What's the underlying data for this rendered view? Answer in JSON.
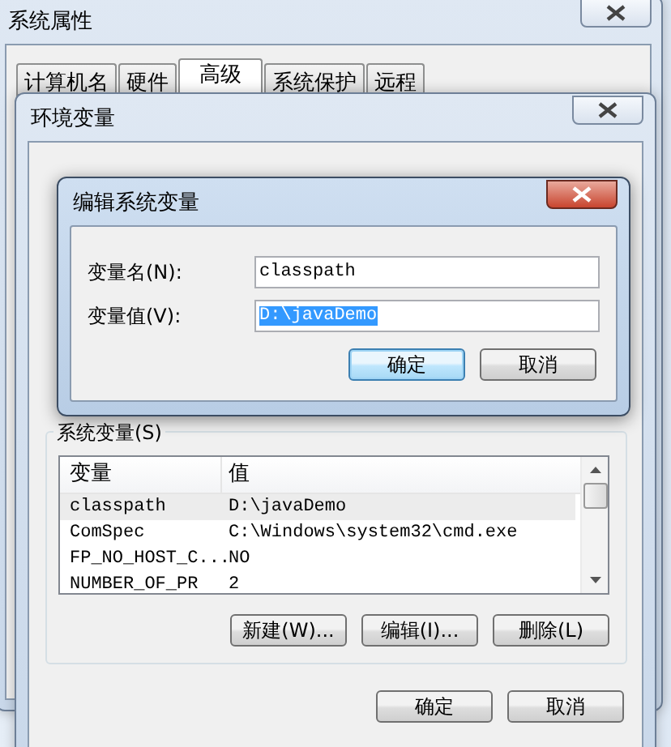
{
  "system_properties": {
    "title": "系统属性",
    "tabs": [
      {
        "label": "计算机名",
        "selected": false
      },
      {
        "label": "硬件",
        "selected": false
      },
      {
        "label": "高级",
        "selected": true
      },
      {
        "label": "系统保护",
        "selected": false
      },
      {
        "label": "远程",
        "selected": false
      }
    ]
  },
  "environment_variables": {
    "title": "环境变量",
    "system_variables": {
      "label": "系统变量(S)",
      "columns": [
        "变量",
        "值"
      ],
      "rows": [
        {
          "name": "classpath",
          "value": "D:\\javaDemo",
          "selected": true
        },
        {
          "name": "ComSpec",
          "value": "C:\\Windows\\system32\\cmd.exe",
          "selected": false
        },
        {
          "name": "FP_NO_HOST_C...",
          "value": "NO",
          "selected": false
        },
        {
          "name": "NUMBER_OF_PR",
          "value": "2",
          "selected": false
        }
      ],
      "buttons": [
        "新建(W)...",
        "编辑(I)...",
        "删除(L)"
      ]
    },
    "buttons": [
      "确定",
      "取消"
    ]
  },
  "edit_dialog": {
    "title": "编辑系统变量",
    "fields": [
      {
        "label": "变量名(N):",
        "value": "classpath",
        "selected": false
      },
      {
        "label": "变量值(V):",
        "value": "D:\\javaDemo",
        "selected": true
      }
    ],
    "buttons": [
      {
        "label": "确定",
        "focused": true
      },
      {
        "label": "取消",
        "focused": false
      }
    ]
  }
}
